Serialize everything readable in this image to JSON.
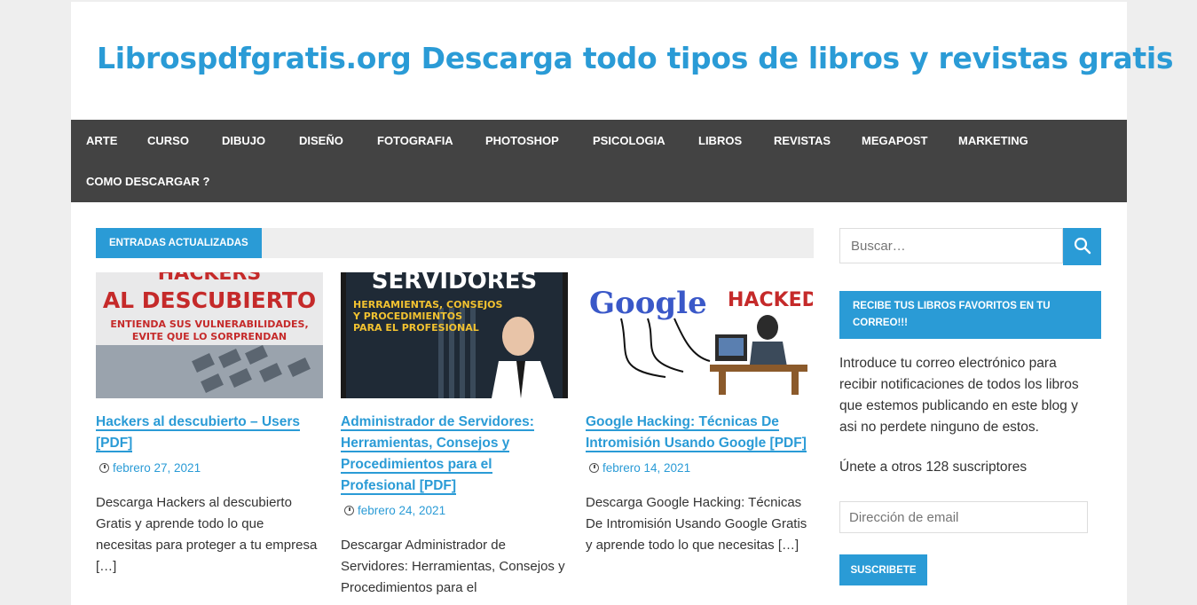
{
  "site": {
    "title": "Librospdfgratis.org Descarga todo tipos de libros y revistas gratis"
  },
  "nav": {
    "items": [
      "ARTE",
      "CURSO",
      "DIBUJO",
      "DISEÑO",
      "FOTOGRAFIA",
      "PHOTOSHOP",
      "PSICOLOGIA",
      "LIBROS",
      "REVISTAS",
      "MEGAPOST",
      "MARKETING",
      "COMO DESCARGAR ?"
    ]
  },
  "section": {
    "label": "ENTRADAS ACTUALIZADAS"
  },
  "posts": [
    {
      "thumb_lines": [
        "HACKERS",
        "AL DESCUBIERTO",
        "ENTIENDA SUS VULNERABILIDADES,",
        "EVITE QUE LO SORPRENDAN"
      ],
      "title": "Hackers al descubierto – Users [PDF]",
      "date": "febrero 27, 2021",
      "excerpt": "Descarga Hackers al descubierto Gratis y aprende todo lo que necesitas para proteger a tu empresa […]"
    },
    {
      "thumb_lines": [
        "SERVIDORES",
        "HERRAMIENTAS, CONSEJOS",
        "Y PROCEDIMIENTOS",
        "PARA EL PROFESIONAL"
      ],
      "title": "Administrador de Servidores: Herramientas, Consejos y Procedimientos para el Profesional [PDF]",
      "date": "febrero 24, 2021",
      "excerpt": "Descargar Administrador de Servidores: Herramientas, Consejos y Procedimientos para el"
    },
    {
      "thumb_lines": [
        "Google",
        "HACKED"
      ],
      "title": "Google Hacking: Técnicas De Intromisión Usando Google [PDF]",
      "date": "febrero 14, 2021",
      "excerpt": "Descarga Google Hacking: Técnicas De Intromisión Usando Google Gratis y aprende todo lo que necesitas […]"
    }
  ],
  "sidebar": {
    "search_placeholder": "Buscar…",
    "widget_title": "RECIBE TUS LIBROS FAVORITOS EN TU CORREO!!!",
    "widget_text": "Introduce tu correo electrónico para recibir notificaciones de todos los libros que estemos publicando en este blog y asi no perdete ninguno de estos.",
    "subscribers": "Únete a otros 128 suscriptores",
    "email_placeholder": "Dirección de email",
    "subscribe_label": "SUSCRIBETE"
  },
  "colors": {
    "accent": "#2a9bd6",
    "nav_bg": "#434343"
  }
}
